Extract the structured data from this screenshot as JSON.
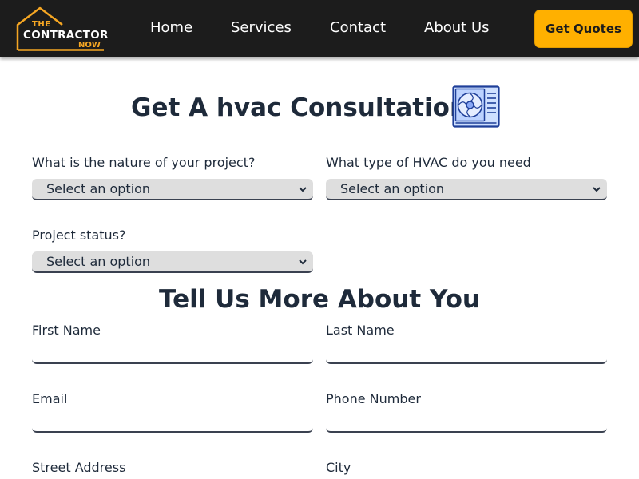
{
  "nav": {
    "logo": {
      "the": "THE",
      "main": "CONTRACTOR",
      "now": "NOW"
    },
    "links": [
      "Home",
      "Services",
      "Contact",
      "About Us"
    ],
    "cta_label": "Get Quotes",
    "colors": {
      "bar": "#1c1c1c",
      "accent": "#ffb000"
    }
  },
  "consultation": {
    "title": "Get A hvac Consultation!",
    "icon": "hvac-unit-icon"
  },
  "project_fields": [
    {
      "label": "What is the nature of your project?",
      "selected": "Select an option"
    },
    {
      "label": "What type of HVAC do you need",
      "selected": "Select an option"
    },
    {
      "label": "Project status?",
      "selected": "Select an option"
    }
  ],
  "about_you": {
    "title": "Tell Us More About You",
    "fields": [
      "First Name",
      "Last Name",
      "Email",
      "Phone Number",
      "Street Address",
      "City"
    ]
  }
}
